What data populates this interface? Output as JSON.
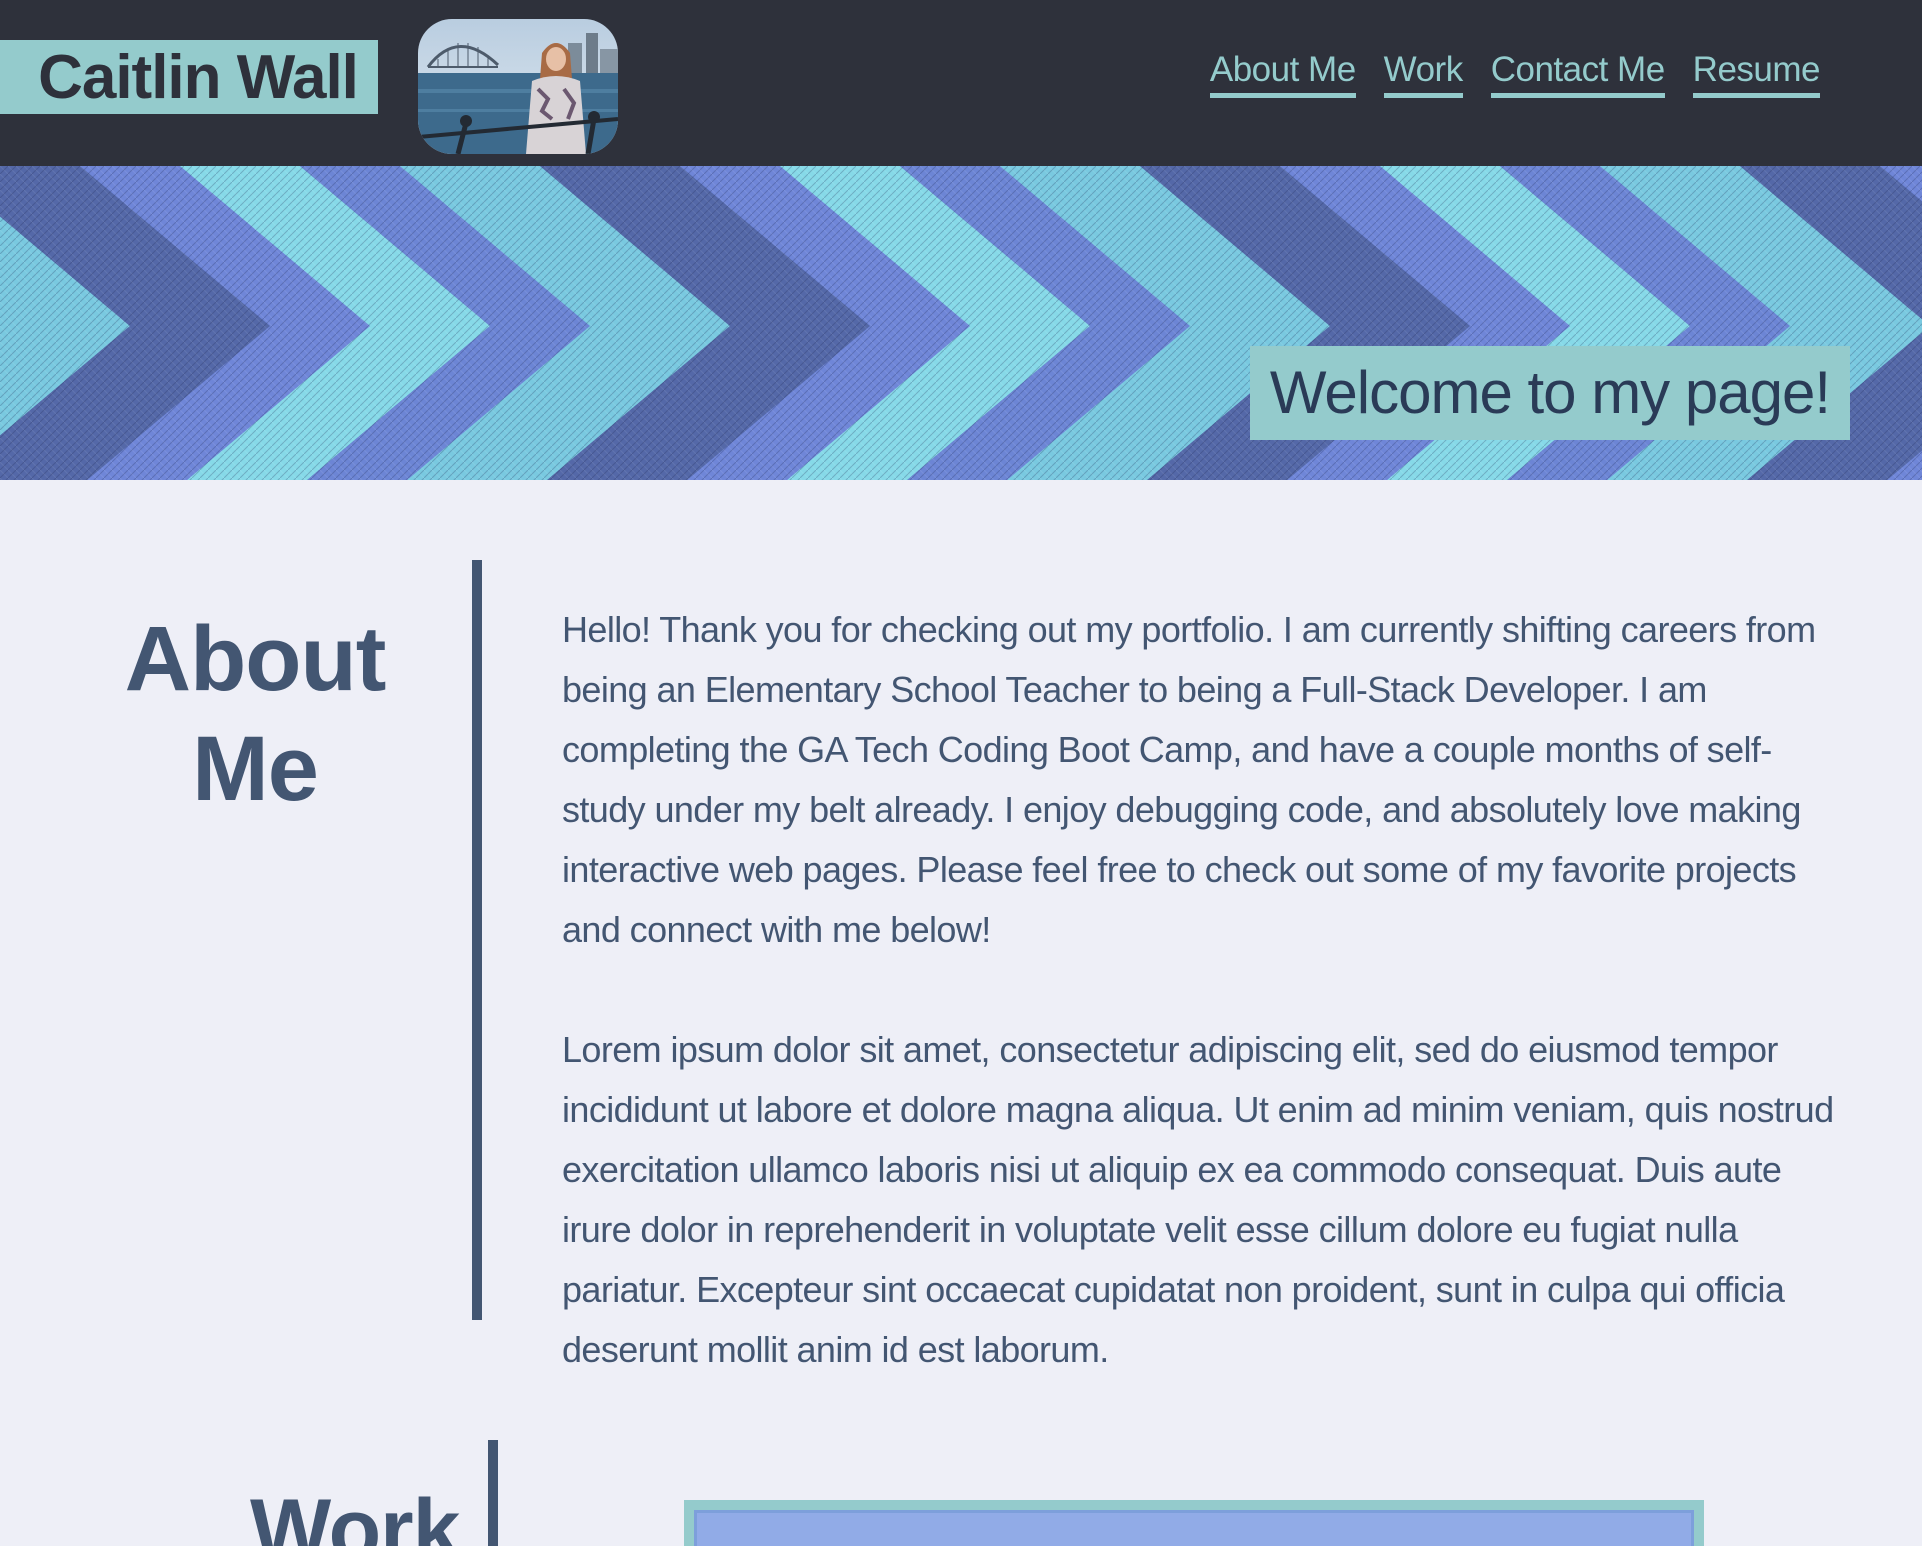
{
  "header": {
    "name": "Caitlin Wall",
    "profile_photo": "profile-photo",
    "nav": [
      {
        "label": "About Me"
      },
      {
        "label": "Work"
      },
      {
        "label": "Contact Me"
      },
      {
        "label": "Resume"
      }
    ]
  },
  "hero": {
    "welcome": "Welcome to my page!"
  },
  "about": {
    "heading_line1": "About",
    "heading_line2": "Me",
    "paragraph1": "Hello! Thank you for checking out my portfolio. I am currently shifting careers from being an Elementary School Teacher to being a Full-Stack Developer. I am completing the GA Tech Coding Boot Camp, and have a couple months of self-study under my belt already. I enjoy debugging code, and absolutely love making interactive web pages. Please feel free to check out some of my favorite projects and connect with me below!",
    "paragraph2": "Lorem ipsum dolor sit amet, consectetur adipiscing elit, sed do eiusmod tempor incididunt ut labore et dolore magna aliqua. Ut enim ad minim veniam, quis nostrud exercitation ullamco laboris nisi ut aliquip ex ea commodo consequat. Duis aute irure dolor in reprehenderit in voluptate velit esse cillum dolore eu fugiat nulla pariatur. Excepteur sint occaecat cupidatat non proident, sunt in culpa qui officia deserunt mollit anim id est laborum."
  },
  "work": {
    "heading": "Work"
  },
  "colors": {
    "header_bg": "#2e313b",
    "accent": "#94cbcc",
    "text": "#435672",
    "page_bg": "#eeeff7",
    "card_inner": "#91abe7"
  }
}
